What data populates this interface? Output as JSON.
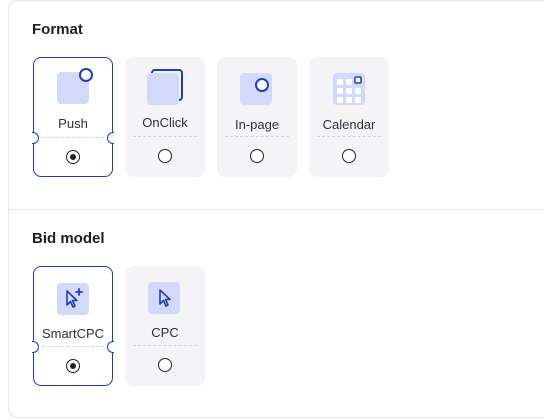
{
  "format": {
    "title": "Format",
    "options": [
      {
        "label": "Push",
        "selected": true,
        "icon": "push-icon"
      },
      {
        "label": "OnClick",
        "selected": false,
        "icon": "onclick-icon"
      },
      {
        "label": "In-page",
        "selected": false,
        "icon": "in-page-icon"
      },
      {
        "label": "Calendar",
        "selected": false,
        "icon": "calendar-icon"
      }
    ]
  },
  "bid_model": {
    "title": "Bid model",
    "options": [
      {
        "label": "SmartCPC",
        "selected": true,
        "icon": "cursor-plus-icon"
      },
      {
        "label": "CPC",
        "selected": false,
        "icon": "cursor-icon"
      }
    ]
  },
  "colors": {
    "accent": "#1d3fb3",
    "icon_fill": "#d2d9fb",
    "card_bg": "#f4f4f6"
  }
}
